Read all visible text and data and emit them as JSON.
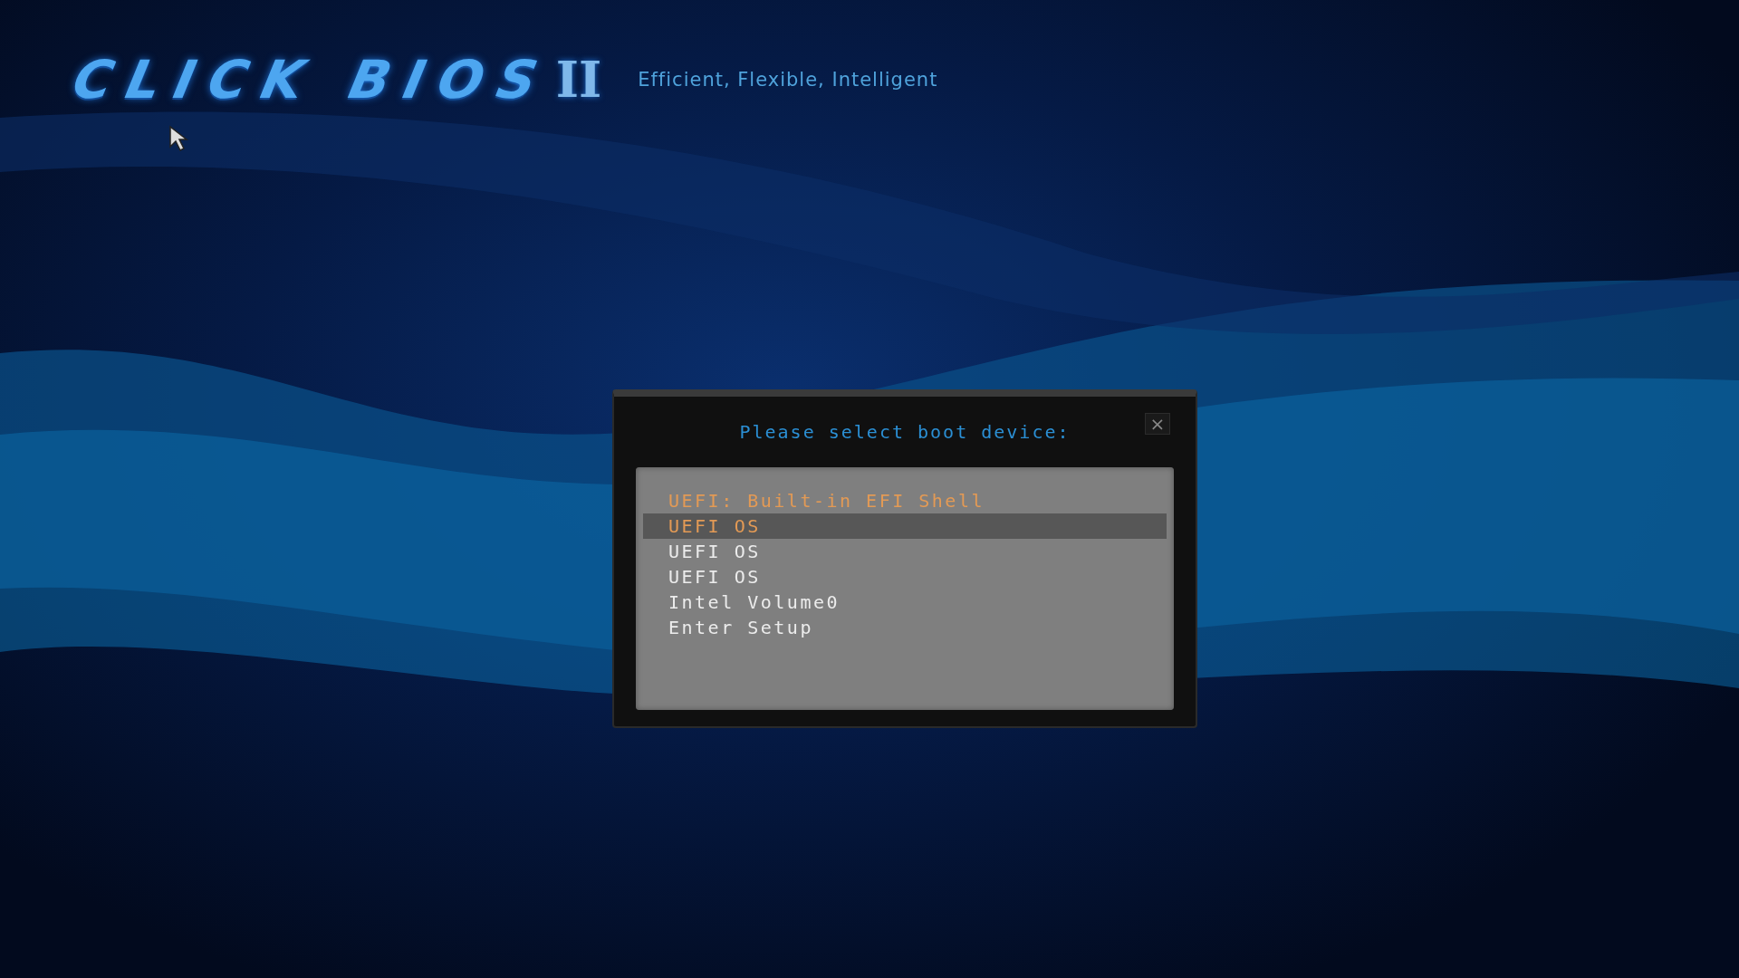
{
  "logo": {
    "text": "CLICK BIOS",
    "suffix": "II"
  },
  "tagline": "Efficient, Flexible, Intelligent",
  "dialog": {
    "title": "Please select boot device:",
    "close": "×",
    "items": [
      {
        "label": "UEFI: Built-in EFI Shell",
        "selected": false,
        "color": "#e39a55"
      },
      {
        "label": "UEFI OS",
        "selected": true,
        "color": "#e39a55"
      },
      {
        "label": "UEFI OS",
        "selected": false,
        "color": "#ececec"
      },
      {
        "label": "UEFI OS",
        "selected": false,
        "color": "#ececec"
      },
      {
        "label": "Intel Volume0",
        "selected": false,
        "color": "#ececec"
      },
      {
        "label": "Enter Setup",
        "selected": false,
        "color": "#ececec"
      }
    ]
  }
}
